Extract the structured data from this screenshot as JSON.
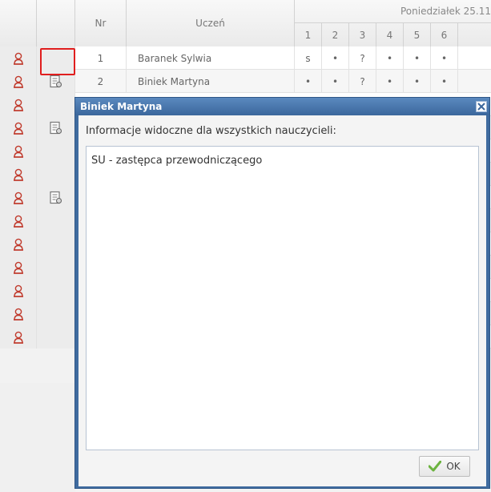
{
  "header": {
    "nr_label": "Nr",
    "student_label": "Uczeń",
    "day_title": "Poniedziałek 25.11",
    "lesson_numbers": [
      "1",
      "2",
      "3",
      "4",
      "5",
      "6"
    ]
  },
  "rows": [
    {
      "nr": "1",
      "name": "Baranek Sylwia",
      "marks": [
        "s",
        "•",
        "?",
        "•",
        "•",
        "•"
      ],
      "has_note": false
    },
    {
      "nr": "2",
      "name": "Biniek Martyna",
      "marks": [
        "•",
        "•",
        "?",
        "•",
        "•",
        "•"
      ],
      "has_note": true
    },
    {
      "has_note": false
    },
    {
      "has_note": true
    },
    {
      "has_note": false
    },
    {
      "has_note": false
    },
    {
      "has_note": true
    },
    {
      "has_note": false
    },
    {
      "has_note": false
    },
    {
      "has_note": false
    },
    {
      "has_note": false
    },
    {
      "has_note": false
    },
    {
      "has_note": false
    }
  ],
  "dialog": {
    "title": "Biniek Martyna",
    "label": "Informacje widoczne dla wszystkich nauczycieli:",
    "text": "SU - zastępca przewodniczącego",
    "ok_label": "OK"
  },
  "colors": {
    "dialog_frame": "#3f6b9f",
    "highlight": "#e01e1e",
    "user_icon": "#c0392b",
    "ok_check": "#6cb33f"
  },
  "icons": [
    "user-icon",
    "note-icon",
    "close-icon",
    "checkmark-icon"
  ]
}
